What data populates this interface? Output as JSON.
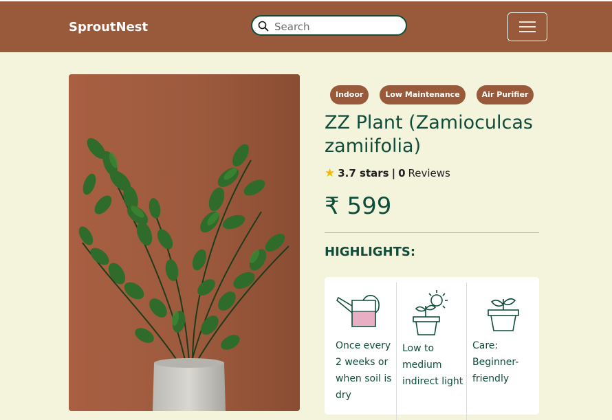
{
  "header": {
    "brand": "SproutNest",
    "search_placeholder": "Search"
  },
  "product": {
    "tags": [
      "Indoor",
      "Low Maintenance",
      "Air Purifier"
    ],
    "title": "ZZ Plant (Zamioculcas zamiifolia)",
    "rating": {
      "stars_text": "3.7 stars",
      "separator": "|",
      "reviews_count": "0",
      "reviews_label": "Reviews"
    },
    "price": "₹ 599",
    "highlights_title": "HIGHLIGHTS:",
    "highlights": [
      {
        "icon": "watering-can-icon",
        "text": "Once every 2 weeks or when soil is dry"
      },
      {
        "icon": "sun-plant-icon",
        "text": "Low to medium indirect light"
      },
      {
        "icon": "potted-plant-icon",
        "text": "Care: Beginner-friendly"
      }
    ]
  },
  "colors": {
    "brand_brown": "#985a3a",
    "background": "#f4f4dc",
    "text_green": "#0f4d3a",
    "star_yellow": "#f5b800"
  }
}
